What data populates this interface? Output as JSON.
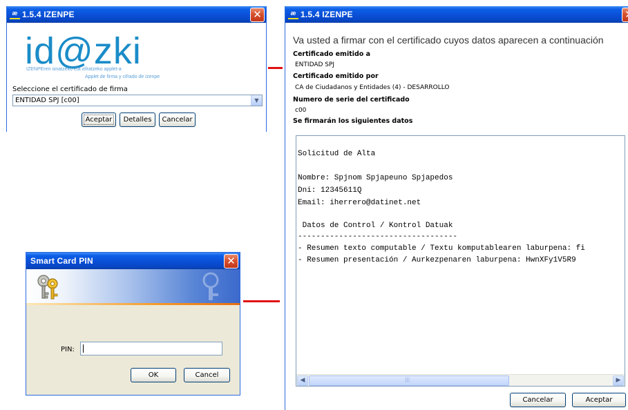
{
  "colors": {
    "titlebar": "#0a4fd6",
    "close": "#d8522e",
    "logo": "#1a8cc8",
    "connector": "#e01010"
  },
  "selector_window": {
    "title": "1.5.4 IZENPE",
    "logo_text": "id@zki",
    "logo_line1": "IZENPEren sinatzeko eta zifratzeko applet-a",
    "logo_line2": "Applet de firma y cifrado de Izenpe",
    "select_label": "Seleccione el certificado de firma",
    "selected_certificate": "ENTIDAD SPJ [c00]",
    "accept_label": "Aceptar",
    "details_label": "Detalles",
    "cancel_label": "Cancelar"
  },
  "pin_window": {
    "title": "Smart Card PIN",
    "pin_label": "PIN:",
    "pin_value": "",
    "ok_label": "OK",
    "cancel_label": "Cancel"
  },
  "data_window": {
    "title": "1.5.4 IZENPE",
    "lead": "Va usted a firmar con el certificado cuyos datos aparecen a continuación",
    "issued_to_label": "Certificado emitido a",
    "issued_to_value": "ENTIDAD SPJ",
    "issued_by_label": "Certificado emitido por",
    "issued_by_value": "CA de Ciudadanos y Entidades (4) - DESARROLLO",
    "serial_label": "Numero de serie del certificado",
    "serial_value": "c00",
    "data_label": "Se firmarán los siguientes datos",
    "document_lines": [
      "Solicitud de Alta",
      "Nombre: Spjnom Spjapeuno Spjapedos",
      "Dni: 12345611Q",
      "Email: iherrero@datinet.net",
      " Datos de Control / Kontrol Datuak",
      "-----------------------------------",
      "- Resumen texto computable / Textu komputablearen laburpena: fi",
      "- Resumen presentación / Aurkezpenaren laburpena: HwnXFy1V5R9"
    ],
    "scroll_grip": "|||",
    "cancel_label": "Cancelar",
    "accept_label": "Aceptar"
  }
}
